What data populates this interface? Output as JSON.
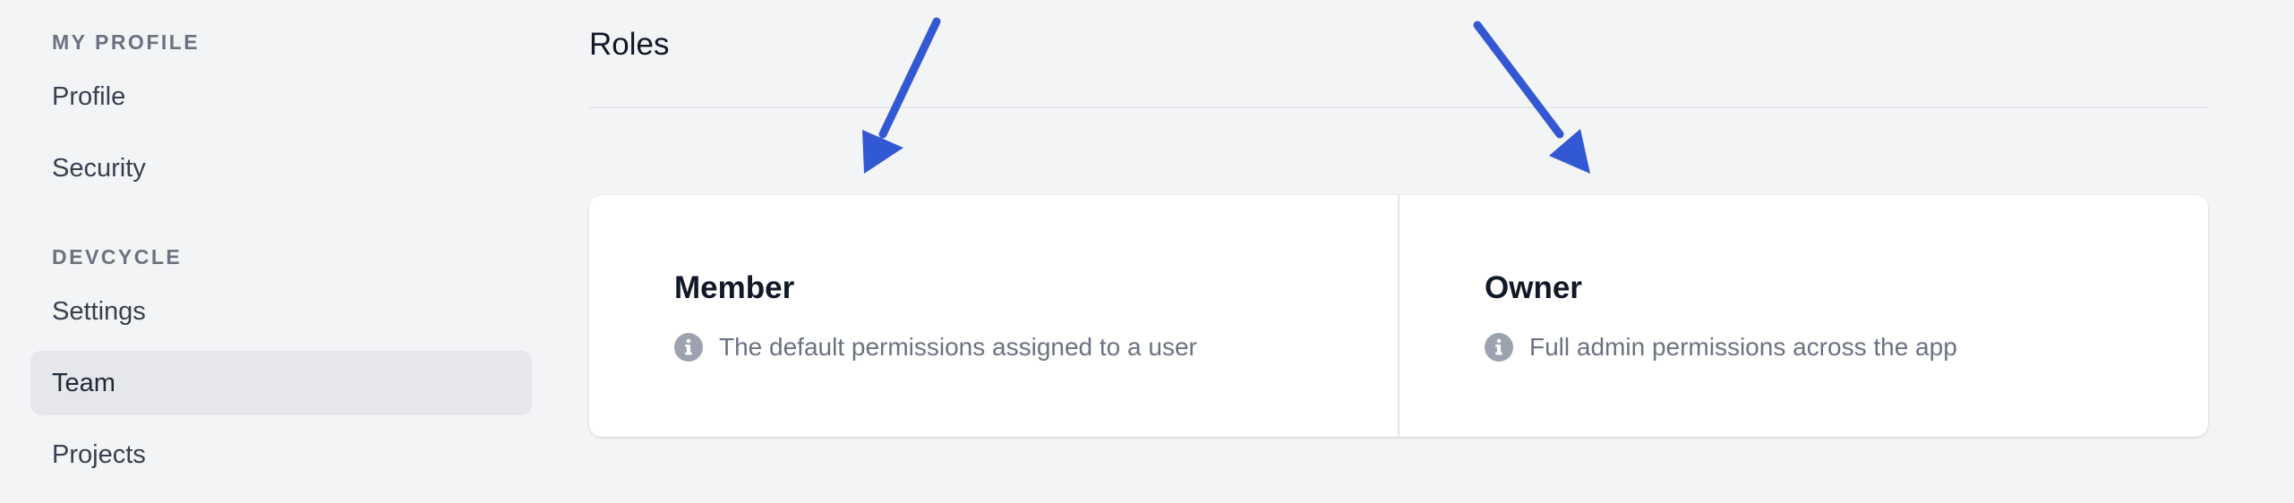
{
  "sidebar": {
    "sections": [
      {
        "heading": "MY PROFILE",
        "items": [
          {
            "label": "Profile"
          },
          {
            "label": "Security"
          }
        ]
      },
      {
        "heading": "DEVCYCLE",
        "items": [
          {
            "label": "Settings"
          },
          {
            "label": "Team",
            "active": true
          },
          {
            "label": "Projects"
          }
        ]
      }
    ]
  },
  "main": {
    "title": "Roles",
    "roles": [
      {
        "name": "Member",
        "description": "The default permissions assigned to a user"
      },
      {
        "name": "Owner",
        "description": "Full admin permissions across the app"
      }
    ]
  },
  "colors": {
    "background": "#f3f4f6",
    "active_nav": "#e5e7eb",
    "annotation_arrow": "#3358d4",
    "info_icon": "#9ca3af"
  },
  "icons": {
    "role_info": "info-circle-icon",
    "annotation": "arrow-icon"
  }
}
